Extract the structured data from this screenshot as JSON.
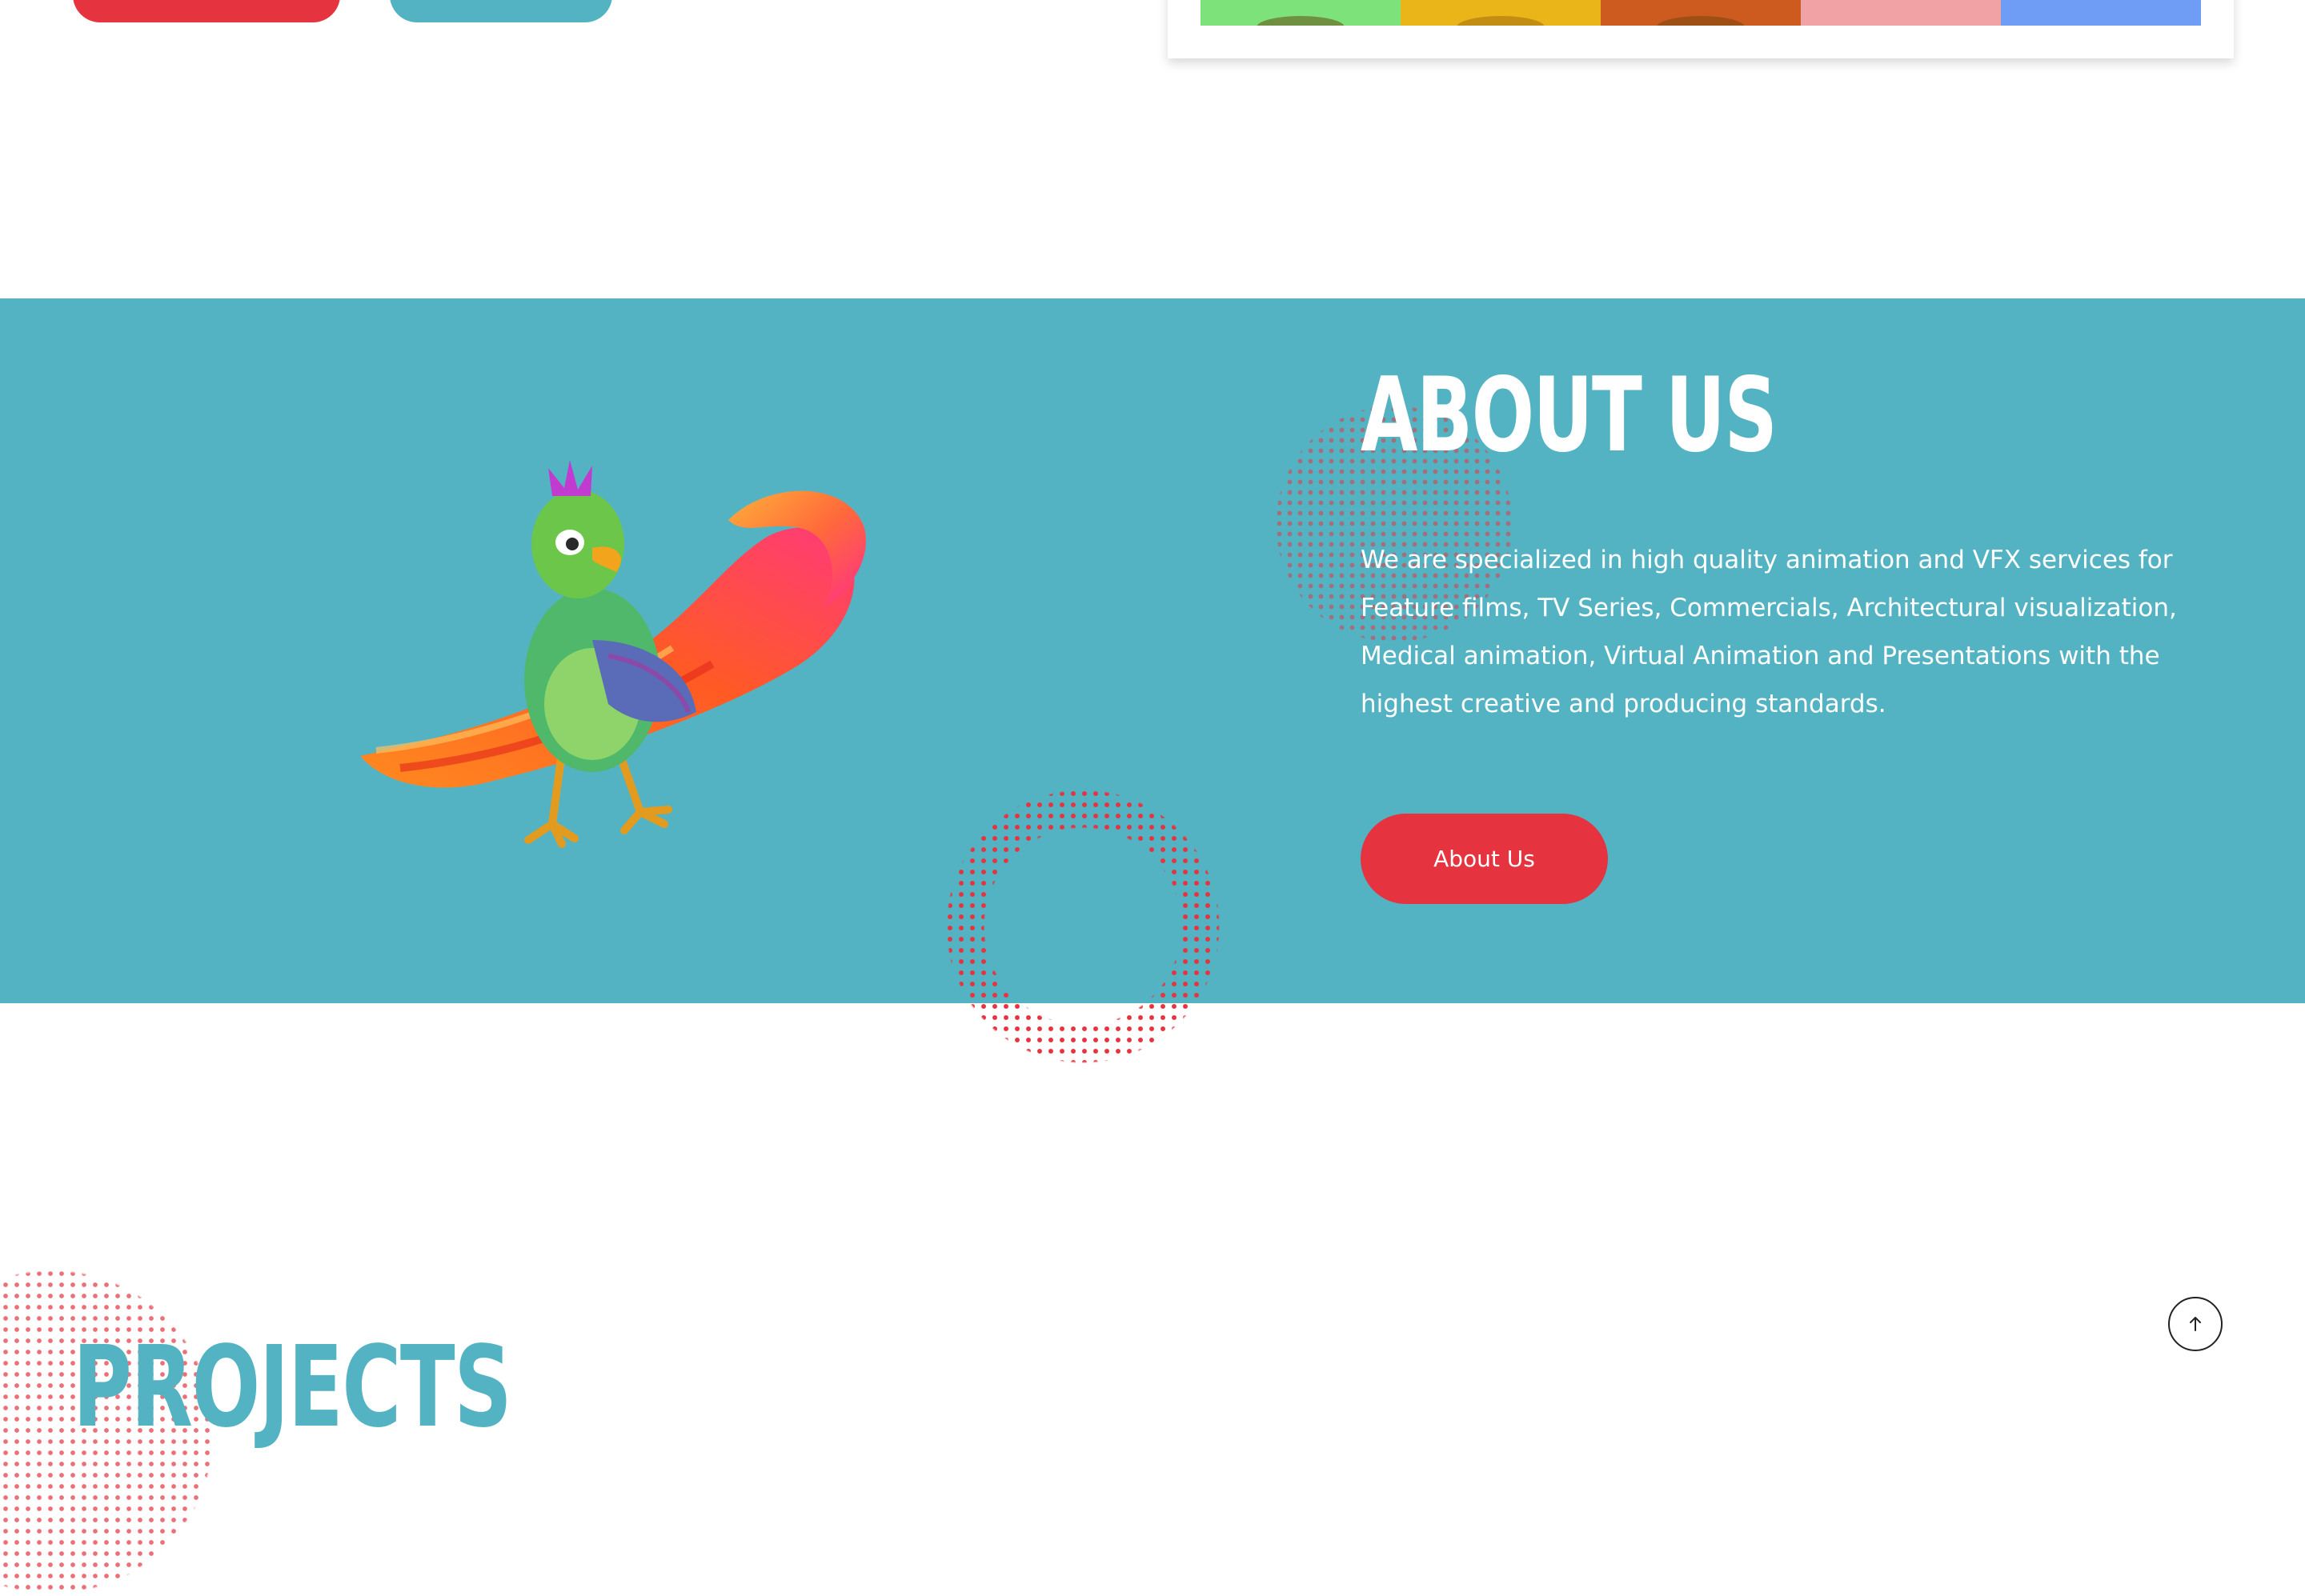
{
  "hero": {
    "primary_button_color": "#e5343f",
    "secondary_button_color": "#53b3c3"
  },
  "gallery": {
    "thumbnail_colors": [
      "#7ee27b",
      "#e9b518",
      "#cd5b20",
      "#f0a2a5",
      "#6f9cf4"
    ]
  },
  "about": {
    "title": "ABOUT US",
    "description": "We are specialized in high quality animation and VFX services for Feature films, TV Series, Commercials, Architectural visualization, Medical animation, Virtual Animation and Presentations with the highest creative and producing standards.",
    "button_label": "About Us",
    "background_color": "#54b3c3",
    "button_color": "#e5343f",
    "illustration": "parrot-character-with-paint-stroke"
  },
  "projects": {
    "title": "PROJECTS"
  },
  "scroll_top": {
    "icon": "arrow-up-icon"
  }
}
